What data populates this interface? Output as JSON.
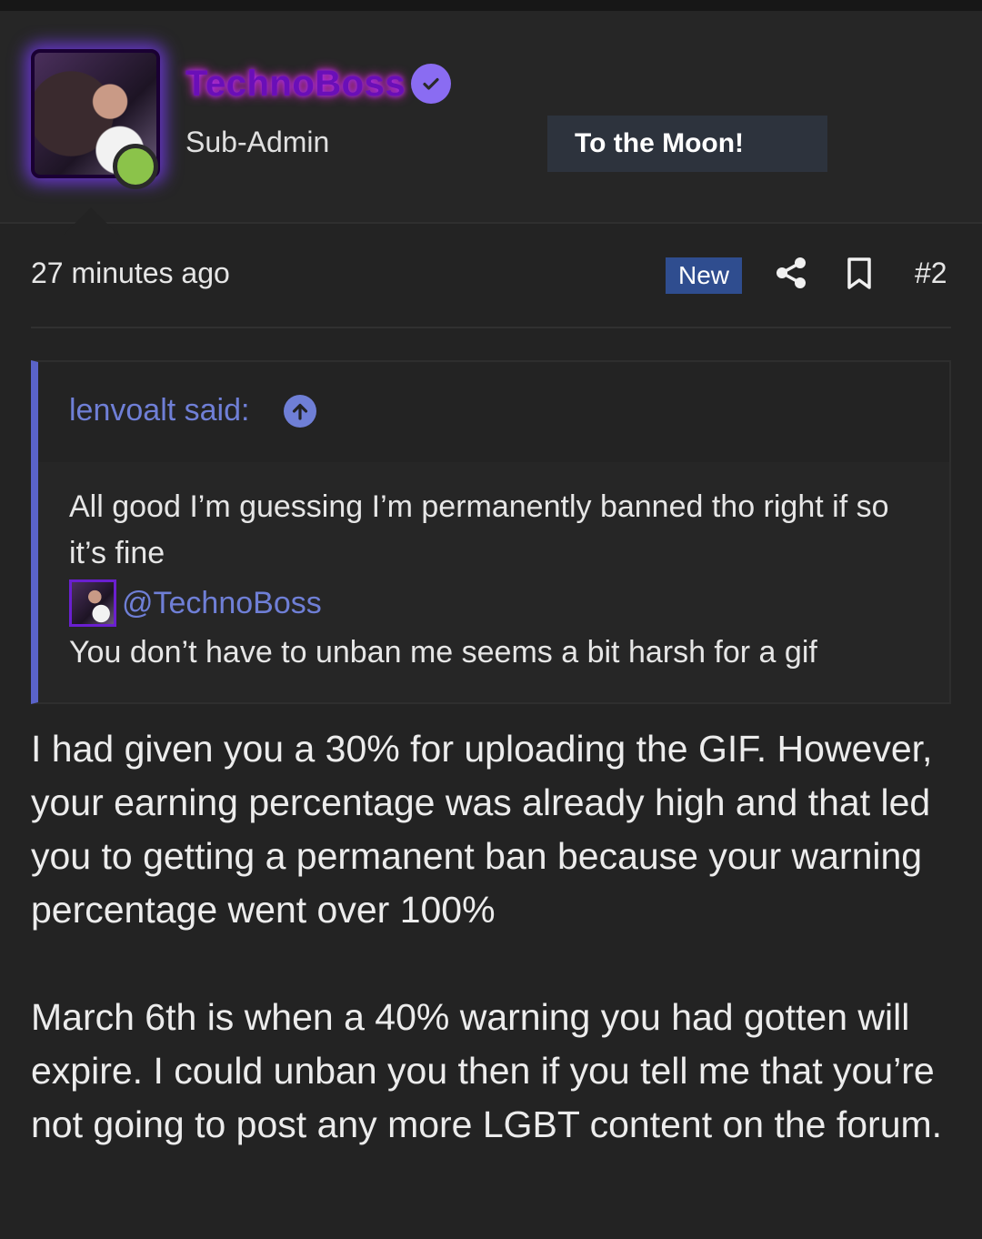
{
  "post": {
    "username": "TechnoBoss",
    "role": "Sub-Admin",
    "user_title": "To the Moon!",
    "time": "27 minutes ago",
    "new_badge": "New",
    "post_number": "#2",
    "icons": {
      "verified": "verified-check-icon",
      "share": "share-icon",
      "bookmark": "bookmark-icon",
      "quote_jump": "arrow-up-circle-icon",
      "online": "online-status-dot"
    },
    "colors": {
      "accent": "#5a63c9",
      "link": "#6f7fd6",
      "verified": "#8a6cf2",
      "online": "#8bc34a",
      "new_badge": "#2f4d8f"
    }
  },
  "quote": {
    "author": "lenvoalt said:",
    "line1": "All good I’m guessing I’m permanently banned tho right if so it’s fine",
    "mention": "@TechnoBoss",
    "line2": "You don’t have to unban me seems a bit harsh for a gif"
  },
  "body": {
    "paragraph1": "I had given you a 30% for uploading the GIF. However, your earning percentage was already high and that led you to getting a permanent ban because your warning percentage went over 100%",
    "paragraph2": "March 6th is when a 40% warning you had gotten will expire. I could unban you then if you tell me that you’re not going to post any more LGBT content on the forum."
  }
}
